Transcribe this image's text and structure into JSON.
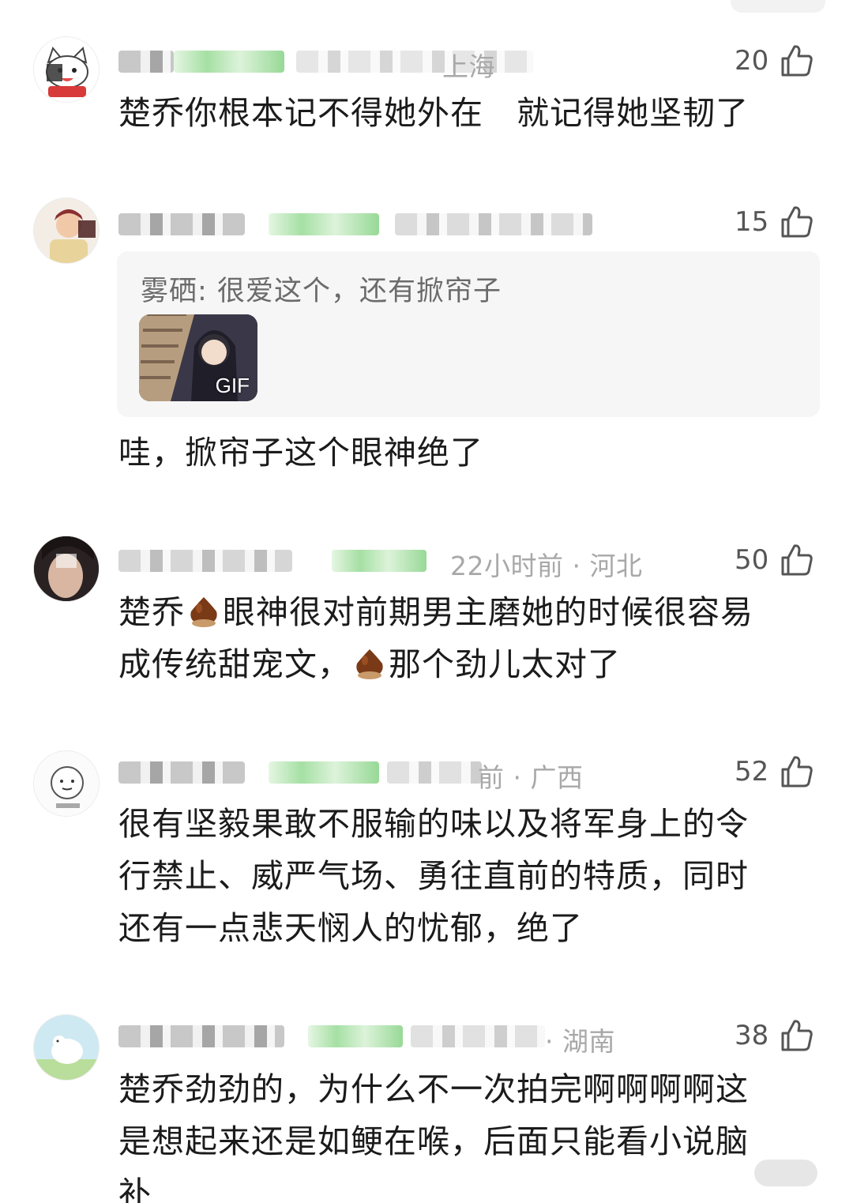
{
  "comments": [
    {
      "meta_visible": "上海",
      "likes": "20",
      "text": "楚乔你根本记不得她外在   就记得她坚韧了"
    },
    {
      "meta_visible": "",
      "likes": "15",
      "quote": {
        "author": "雾硒",
        "separator": ":",
        "text": "很爱这个，还有掀帘子",
        "gif_label": "GIF"
      },
      "text": "哇，掀帘子这个眼神绝了"
    },
    {
      "meta_visible": "22小时前 · 河北",
      "likes": "50",
      "text_parts": [
        "楚乔",
        "眼神很对前期男主磨她的时候很容易",
        "成传统甜宠文，",
        "那个劲儿太对了"
      ],
      "emoji": "chestnut-emoji"
    },
    {
      "meta_visible": "前 · 广西",
      "likes": "52",
      "text_lines": [
        "很有坚毅果敢不服输的味以及将军身上的令",
        "行禁止、威严气场、勇往直前的特质，同时",
        "还有一点悲天悯人的忧郁，绝了"
      ]
    },
    {
      "meta_visible": "· 湖南",
      "likes": "38",
      "text_lines": [
        "楚乔劲劲的，为什么不一次拍完啊啊啊啊这",
        "是想起来还是如鲠在喉，后面只能看小说脑",
        "补"
      ]
    }
  ],
  "icons": {
    "like": "thumbs-up-icon",
    "emoji": "chestnut-icon"
  },
  "colors": {
    "meta_gray": "#a8a8a8",
    "body_text": "#1b1b1b",
    "quote_bg": "#f6f6f6",
    "badge_green": "#8fd88d"
  }
}
